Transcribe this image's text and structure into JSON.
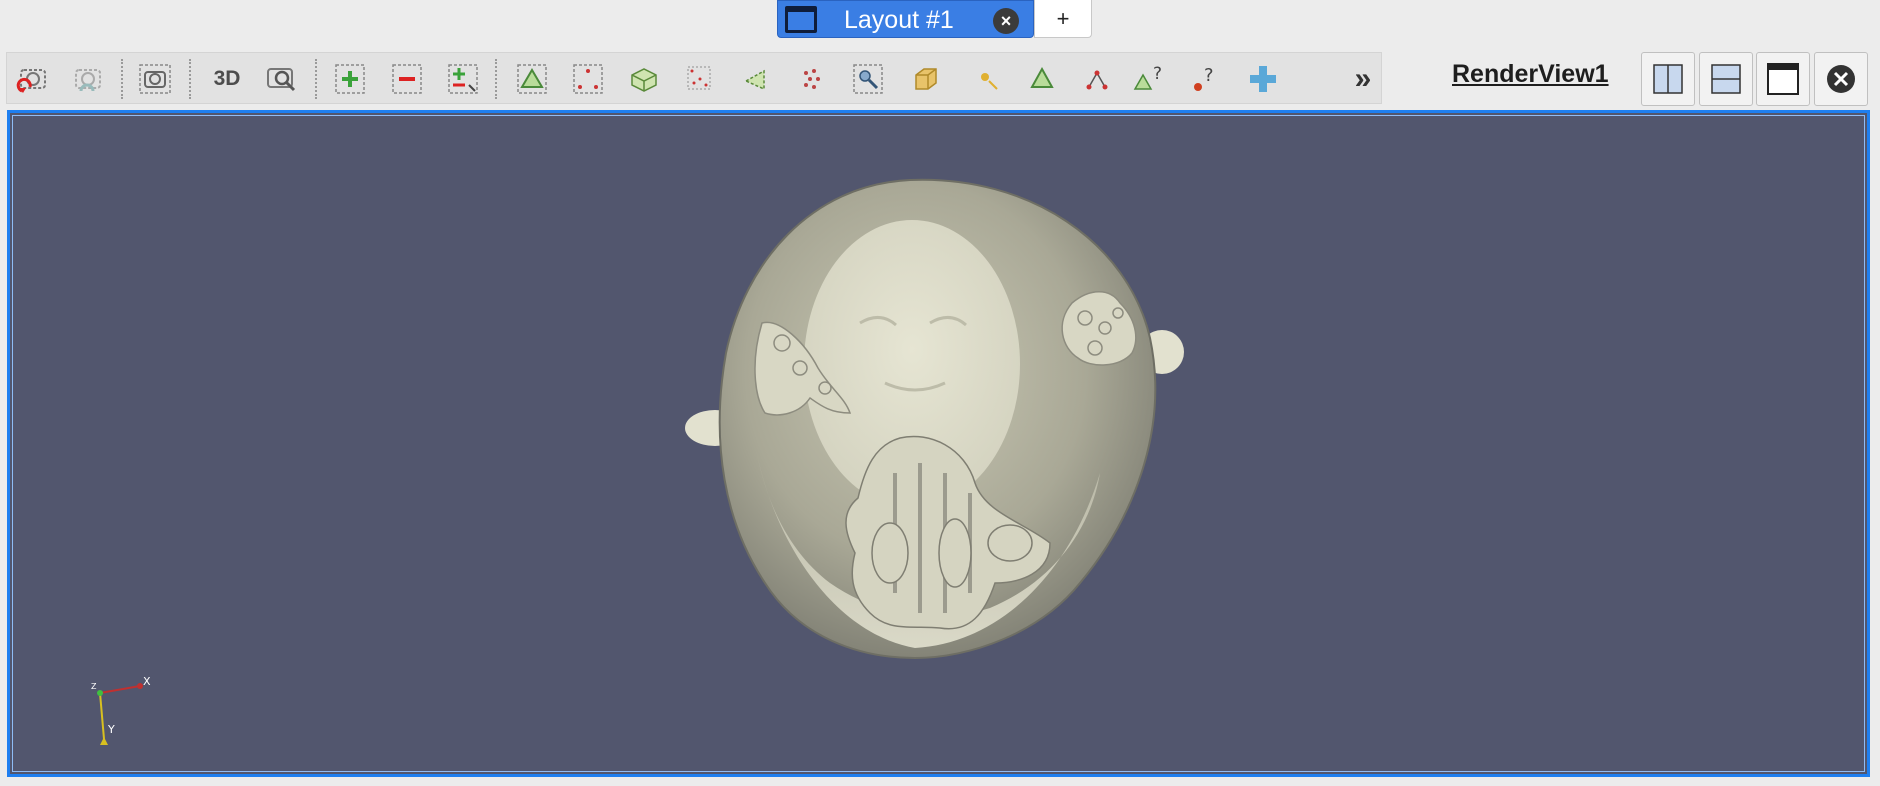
{
  "tabs": {
    "active": {
      "label": "Layout #1"
    },
    "add_label": "+"
  },
  "toolbar": {
    "items": [
      "reset-camera-icon",
      "reset-camera-closest-icon",
      "capture-screenshot-icon",
      "3D",
      "zoom-to-box-icon",
      "add-selection-icon",
      "subtract-selection-icon",
      "toggle-selection-icon",
      "select-cells-on-icon",
      "select-points-on-icon",
      "select-cells-through-icon",
      "select-points-through-icon",
      "select-cells-polygon-icon",
      "select-points-polygon-icon",
      "select-block-icon",
      "interactive-select-icon",
      "hover-points-icon",
      "hover-cells-icon",
      "grow-selection-icon",
      "query-cells-icon",
      "query-points-icon",
      "clear-selection-icon",
      "more-chevron-icon"
    ],
    "label_3d": "3D",
    "more_label": "»"
  },
  "view": {
    "title": "RenderView1",
    "background": "#52566e",
    "border_accent": "#1e7ff0"
  },
  "axes": {
    "x": "X",
    "y": "Y",
    "z": "Z"
  },
  "colors": {
    "tab_active": "#3a7ee4",
    "surface": "#d9d8c6"
  }
}
